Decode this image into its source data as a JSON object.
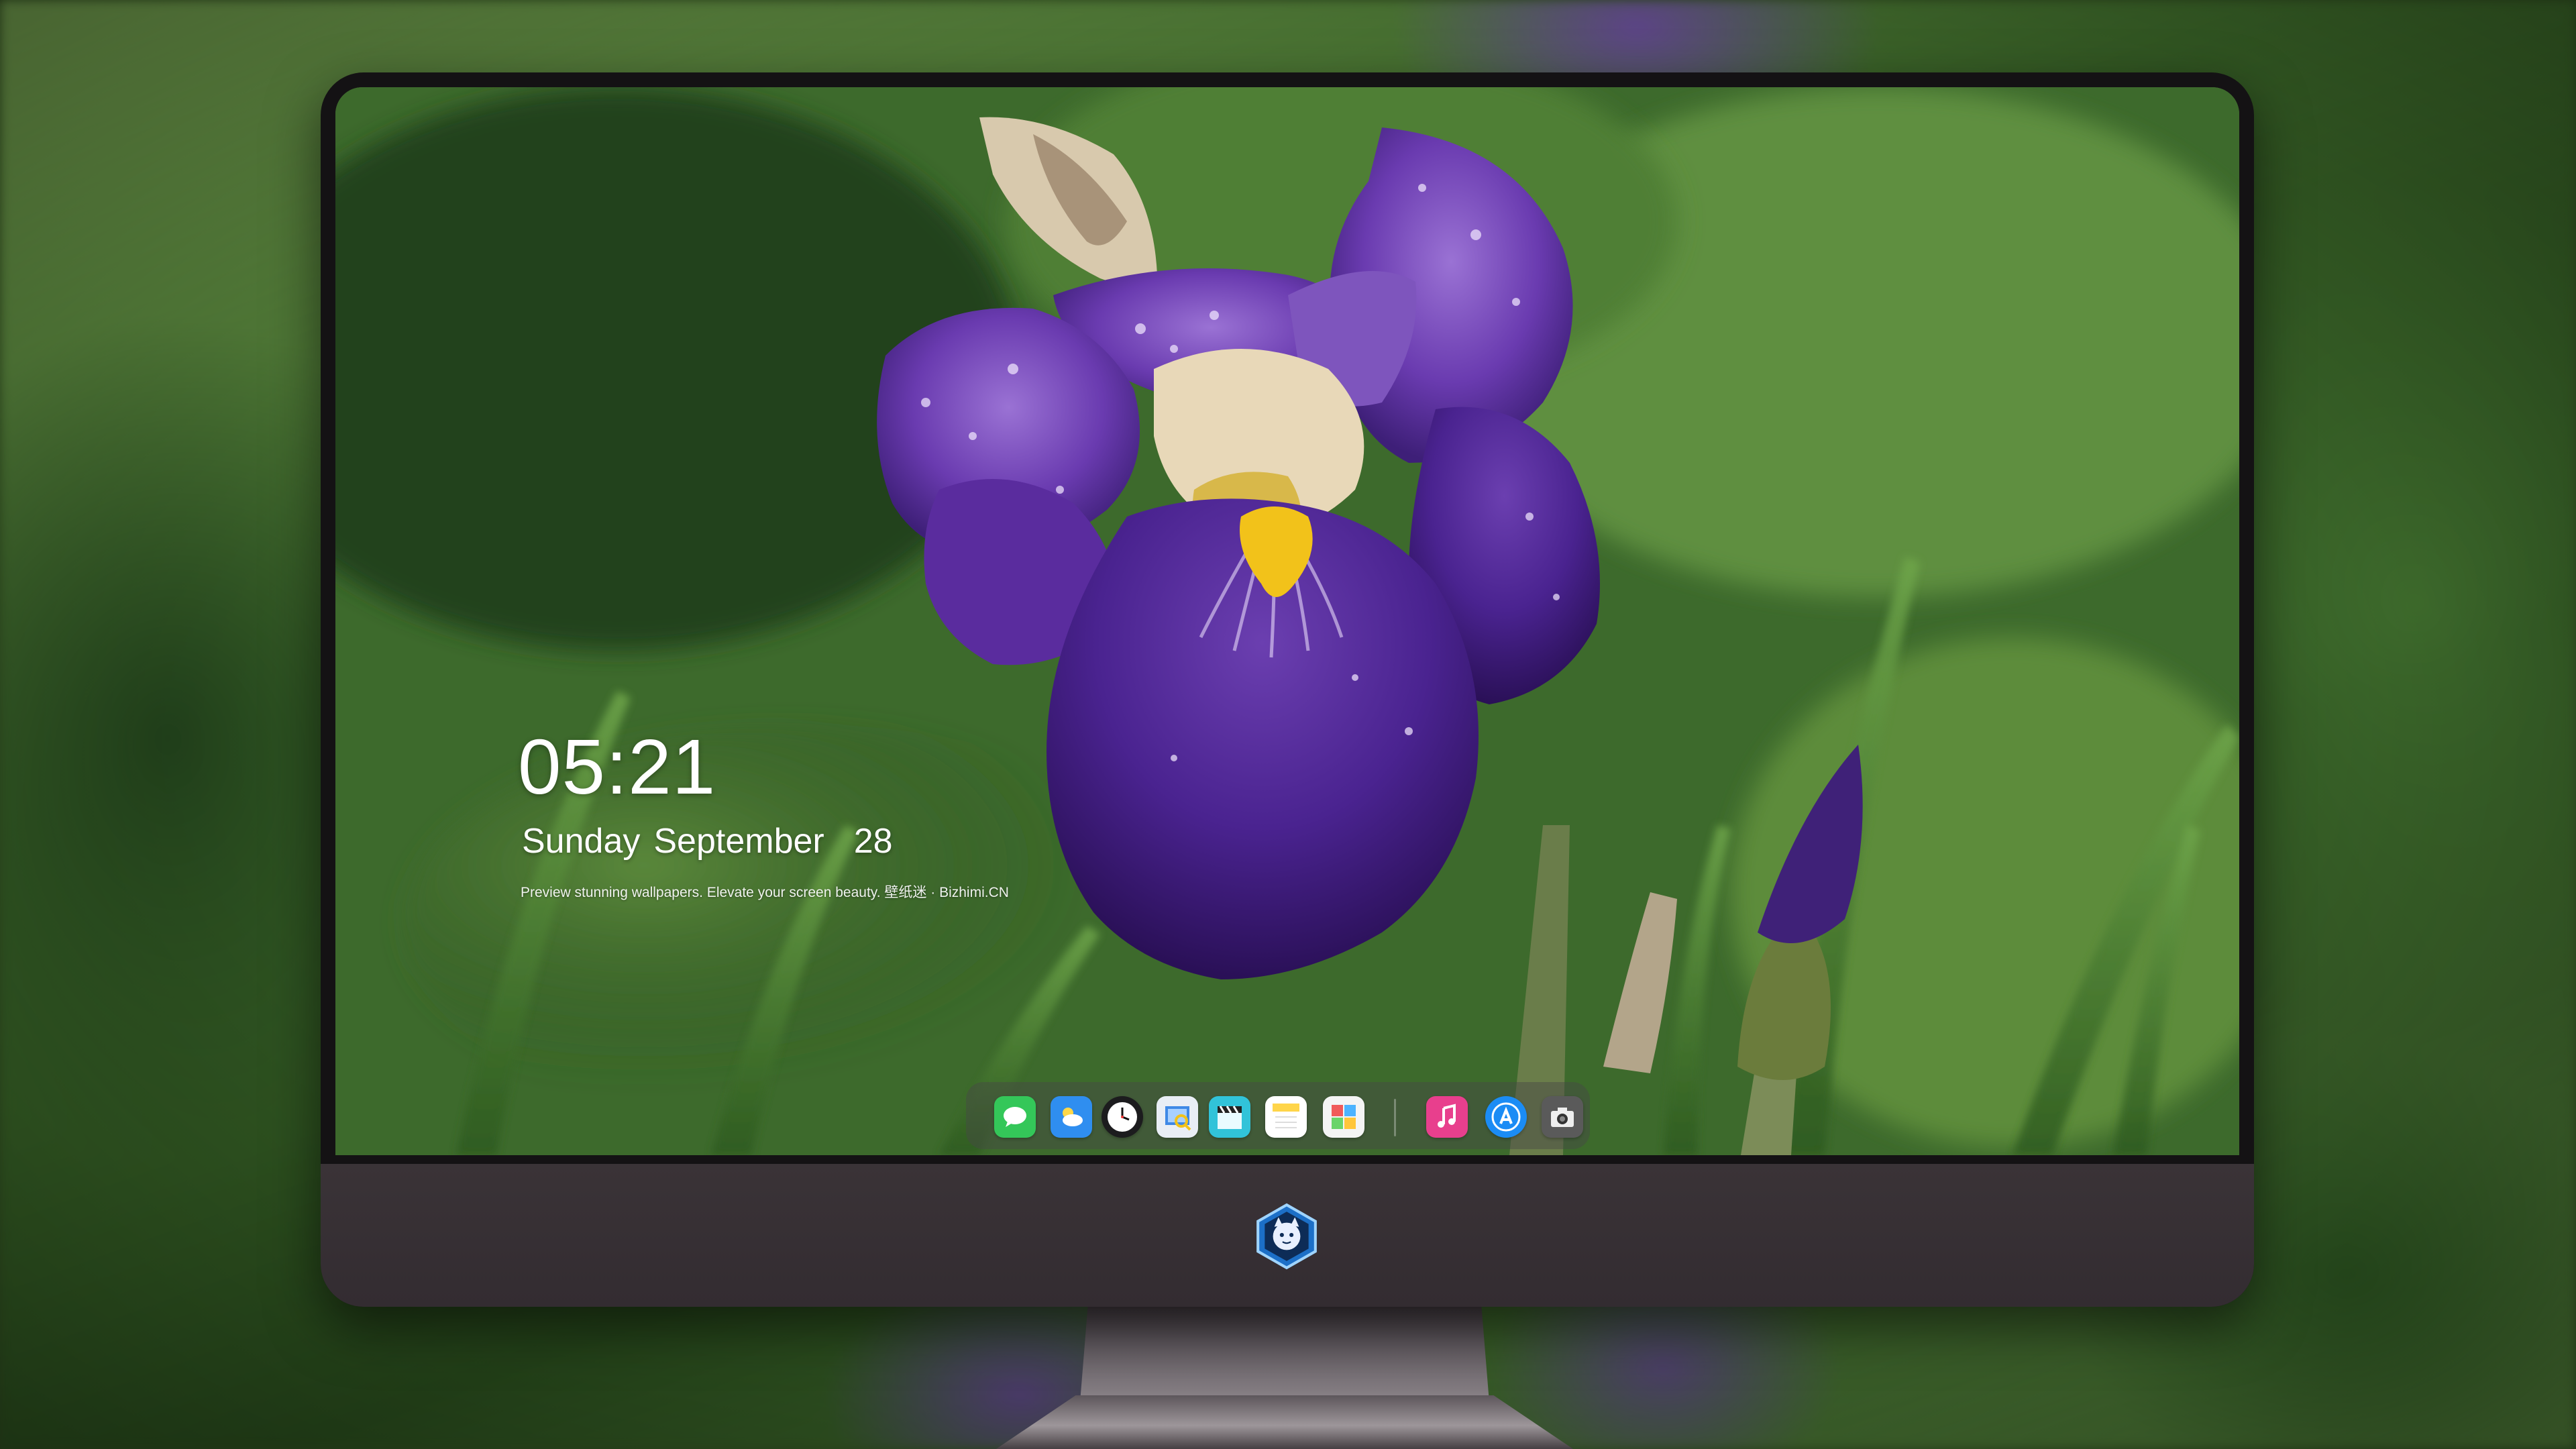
{
  "lockscreen": {
    "time": "05:21",
    "weekday": "Sunday",
    "month": "September",
    "day": "28",
    "tagline": "Preview stunning wallpapers. Elevate your screen beauty. 壁纸迷 · Bizhimi.CN"
  },
  "dock": {
    "apps": [
      {
        "name": "Messages",
        "icon": "messages-icon",
        "color": "#34c759"
      },
      {
        "name": "Weather",
        "icon": "weather-icon",
        "color": "#2f8ef0"
      },
      {
        "name": "Clock",
        "icon": "clock-icon",
        "color": "#1c1c1e"
      },
      {
        "name": "Preview",
        "icon": "preview-icon",
        "color": "#3f89e6"
      },
      {
        "name": "Clips",
        "icon": "clapperboard-icon",
        "color": "#31c3d9"
      },
      {
        "name": "Notes",
        "icon": "notes-icon",
        "color": "#ffd54a"
      },
      {
        "name": "Photo Booth",
        "icon": "photo-booth-icon",
        "color": "#f4f4f4"
      },
      {
        "name": "Music",
        "icon": "music-icon",
        "color": "#e83f8d"
      },
      {
        "name": "App Store",
        "icon": "app-store-icon",
        "color": "#1b8cf5"
      },
      {
        "name": "Screenshot",
        "icon": "camera-icon",
        "color": "#5a5a5a"
      }
    ]
  },
  "colors": {
    "iris_petal": "#5b2fa0",
    "iris_light": "#8b62c8",
    "beard_yellow": "#f2c21a",
    "foliage": "#3b6a2b",
    "monitor_chin": "#3a3337"
  }
}
